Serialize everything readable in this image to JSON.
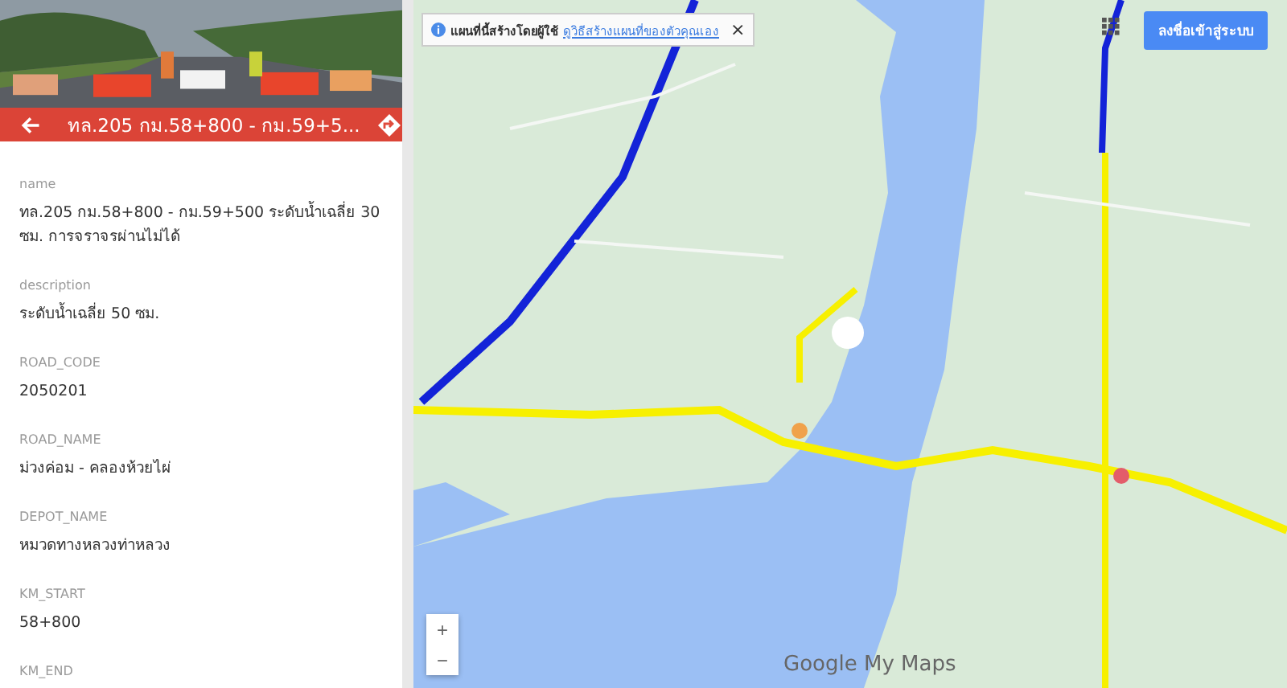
{
  "header": {
    "title": "ทล.205 กม.58+800 - กม.59+5..."
  },
  "fields": [
    {
      "label": "name",
      "value": "ทล.205 กม.58+800 - กม.59+500 ระดับน้ำเฉลี่ย 30 ซม. การจราจรผ่านไม่ได้"
    },
    {
      "label": "description",
      "value": "ระดับน้ำเฉลี่ย 50 ซม."
    },
    {
      "label": "ROAD_CODE",
      "value": "2050201"
    },
    {
      "label": "ROAD_NAME",
      "value": "ม่วงค่อม - คลองห้วยไผ่"
    },
    {
      "label": "DEPOT_NAME",
      "value": "หมวดทางหลวงท่าหลวง"
    },
    {
      "label": "KM_START",
      "value": "58+800"
    },
    {
      "label": "KM_END"
    }
  ],
  "map": {
    "kind": "picture",
    "banner": {
      "text": "แผนที่นี้สร้างโดยผู้ใช้",
      "link": "ดูวิธีสร้างแผนที่ของตัวคุณเอง",
      "close": "×"
    },
    "sign_in": "ลงชื่อเข้าสู่ระบบ",
    "zoom": [
      "+",
      "−"
    ],
    "logo": "Google My Maps"
  }
}
